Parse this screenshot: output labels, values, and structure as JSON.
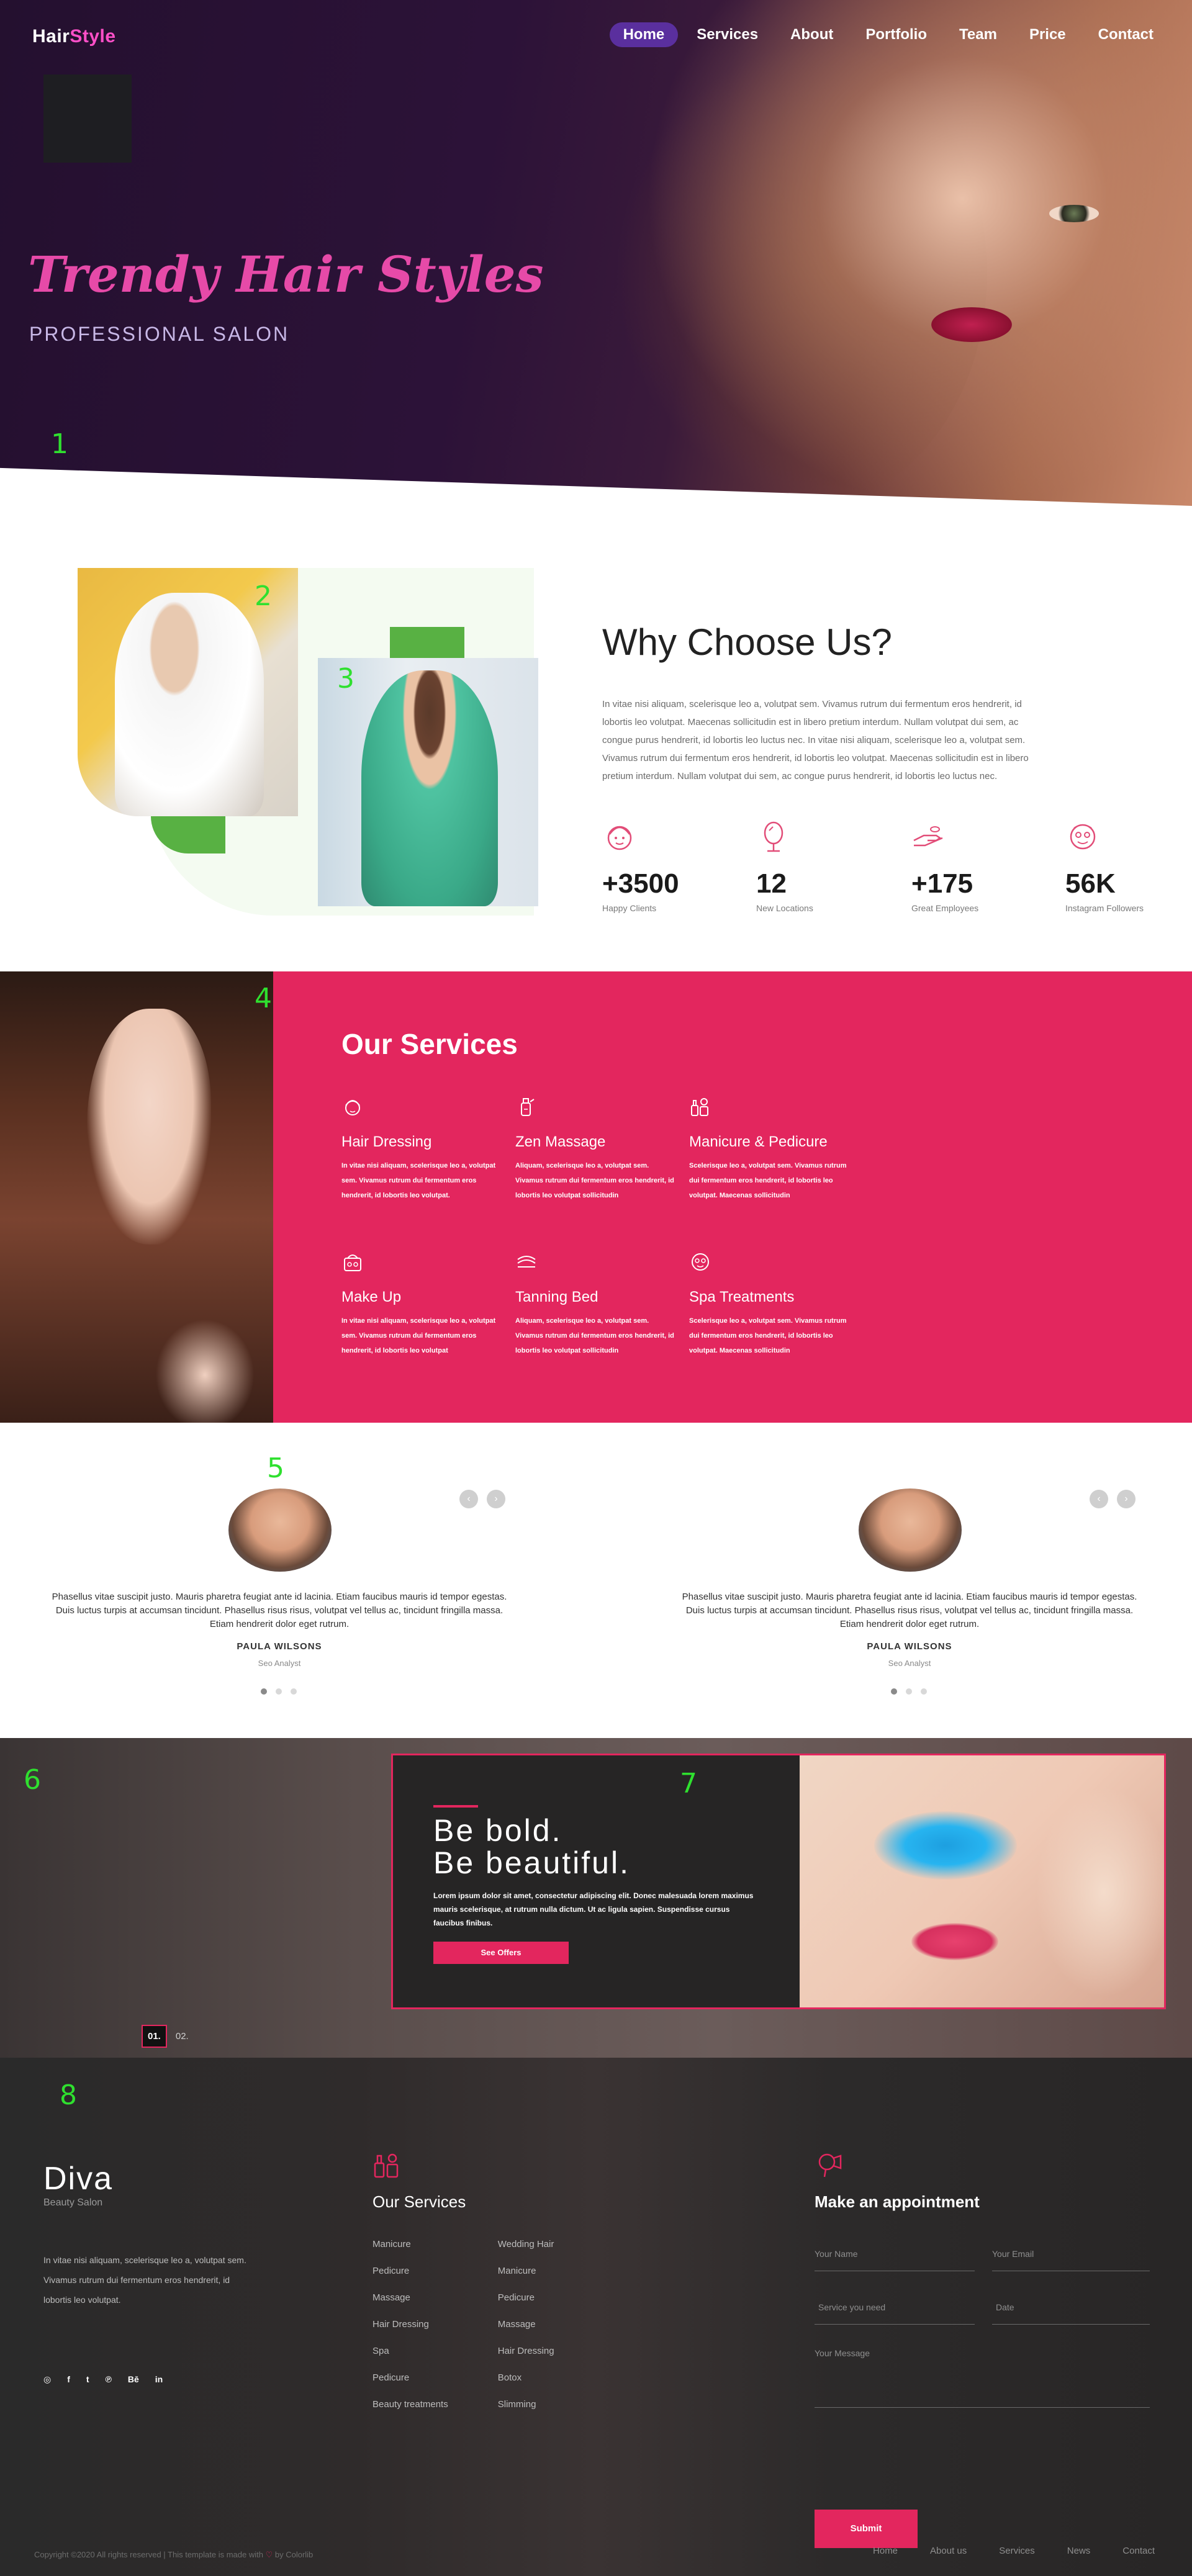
{
  "brand": {
    "name_part1": "Hair",
    "name_part2": "Style"
  },
  "nav": [
    "Home",
    "Services",
    "About",
    "Portfolio",
    "Team",
    "Price",
    "Contact"
  ],
  "hero": {
    "title": "Trendy Hair Styles",
    "subtitle": "PROFESSIONAL SALON"
  },
  "markers": [
    "1",
    "2",
    "3",
    "4",
    "5",
    "6",
    "7",
    "8"
  ],
  "why": {
    "title": "Why Choose Us?",
    "text": "In vitae nisi aliquam, scelerisque leo a, volutpat sem. Vivamus rutrum dui fermentum eros hendrerit, id lobortis leo volutpat. Maecenas sollicitudin est in libero pretium interdum. Nullam volutpat dui sem, ac congue purus hendrerit, id lobortis leo luctus nec. In vitae nisi aliquam, scelerisque leo a, volutpat sem. Vivamus rutrum dui fermentum eros hendrerit, id lobortis leo volutpat. Maecenas sollicitudin est in libero pretium interdum. Nullam volutpat dui sem, ac congue purus hendrerit, id lobortis leo luctus nec.",
    "stats": [
      {
        "icon": "face-icon",
        "value": "+3500",
        "label": "Happy Clients"
      },
      {
        "icon": "mirror-icon",
        "value": "12",
        "label": "New Locations"
      },
      {
        "icon": "hand-icon",
        "value": "+175",
        "label": "Great Employees"
      },
      {
        "icon": "mask-icon",
        "value": "56K",
        "label": "Instagram Followers"
      }
    ]
  },
  "services": {
    "title": "Our Services",
    "items": [
      {
        "icon": "face-icon",
        "name": "Hair Dressing",
        "desc": "In vitae nisi aliquam, scelerisque leo a, volutpat sem. Vivamus rutrum dui fermentum eros hendrerit, id lobortis leo volutpat."
      },
      {
        "icon": "bottle-icon",
        "name": "Zen Massage",
        "desc": "Aliquam, scelerisque leo a, volutpat sem. Vivamus rutrum dui fermentum eros hendrerit, id lobortis leo volutpat sollicitudin"
      },
      {
        "icon": "nail-polish-icon",
        "name": "Manicure & Pedicure",
        "desc": "Scelerisque leo a, volutpat sem. Vivamus rutrum dui fermentum eros hendrerit, id lobortis leo volutpat. Maecenas sollicitudin"
      },
      {
        "icon": "makeup-icon",
        "name": "Make Up",
        "desc": "In vitae nisi aliquam, scelerisque leo a, volutpat sem. Vivamus rutrum dui fermentum eros hendrerit, id lobortis leo volutpat"
      },
      {
        "icon": "tanning-icon",
        "name": "Tanning Bed",
        "desc": "Aliquam, scelerisque leo a, volutpat sem. Vivamus rutrum dui fermentum eros hendrerit, id lobortis leo volutpat sollicitudin"
      },
      {
        "icon": "spa-mask-icon",
        "name": "Spa Treatments",
        "desc": "Scelerisque leo a, volutpat sem. Vivamus rutrum dui fermentum eros hendrerit, id lobortis leo volutpat. Maecenas sollicitudin"
      }
    ]
  },
  "testimonials": [
    {
      "quote": "Phasellus vitae suscipit justo. Mauris pharetra feugiat ante id lacinia. Etiam faucibus mauris id tempor egestas. Duis luctus turpis at accumsan tincidunt. Phasellus risus risus, volutpat vel tellus ac, tincidunt fringilla massa. Etiam hendrerit dolor eget rutrum.",
      "name": "PAULA WILSONS",
      "role": "Seo Analyst"
    },
    {
      "quote": "Phasellus vitae suscipit justo. Mauris pharetra feugiat ante id lacinia. Etiam faucibus mauris id tempor egestas. Duis luctus turpis at accumsan tincidunt. Phasellus risus risus, volutpat vel tellus ac, tincidunt fringilla massa. Etiam hendrerit dolor eget rutrum.",
      "name": "PAULA WILSONS",
      "role": "Seo Analyst"
    }
  ],
  "promo": {
    "title_line1": "Be bold.",
    "title_line2": "Be beautiful.",
    "text": "Lorem ipsum dolor sit amet, consectetur adipiscing elit. Donec malesuada lorem maximus mauris scelerisque, at rutrum nulla dictum. Ut ac ligula sapien. Suspendisse cursus faucibus finibus.",
    "button": "See Offers",
    "pager": [
      "01.",
      "02."
    ]
  },
  "footer": {
    "brand": "Diva",
    "brand_sub": "Beauty Salon",
    "about": "In vitae nisi aliquam, scelerisque leo a, volutpat sem. Vivamus rutrum dui fermentum eros hendrerit, id lobortis leo volutpat.",
    "socials": [
      "◎",
      "f",
      "t",
      "℗",
      "Bē",
      "in"
    ],
    "services_title": "Our Services",
    "services_col1": [
      "Manicure",
      "Pedicure",
      "Massage",
      "Hair Dressing",
      "Spa",
      "Pedicure",
      "Beauty treatments"
    ],
    "services_col2": [
      "Wedding Hair",
      "Manicure",
      "Pedicure",
      "Massage",
      "Hair Dressing",
      "Botox",
      "Slimming"
    ],
    "appointment_title": "Make an appointment",
    "placeholders": {
      "name": "Your Name",
      "email": "Your Email",
      "service": "Service you need",
      "date": "Date",
      "message": "Your Message"
    },
    "submit": "Submit",
    "copyright_pre": "Copyright ©2020 All rights reserved | This template is made with",
    "copyright_heart": "♡",
    "copyright_post": "by Colorlib",
    "links": [
      "Home",
      "About us",
      "Services",
      "News",
      "Contact"
    ]
  }
}
